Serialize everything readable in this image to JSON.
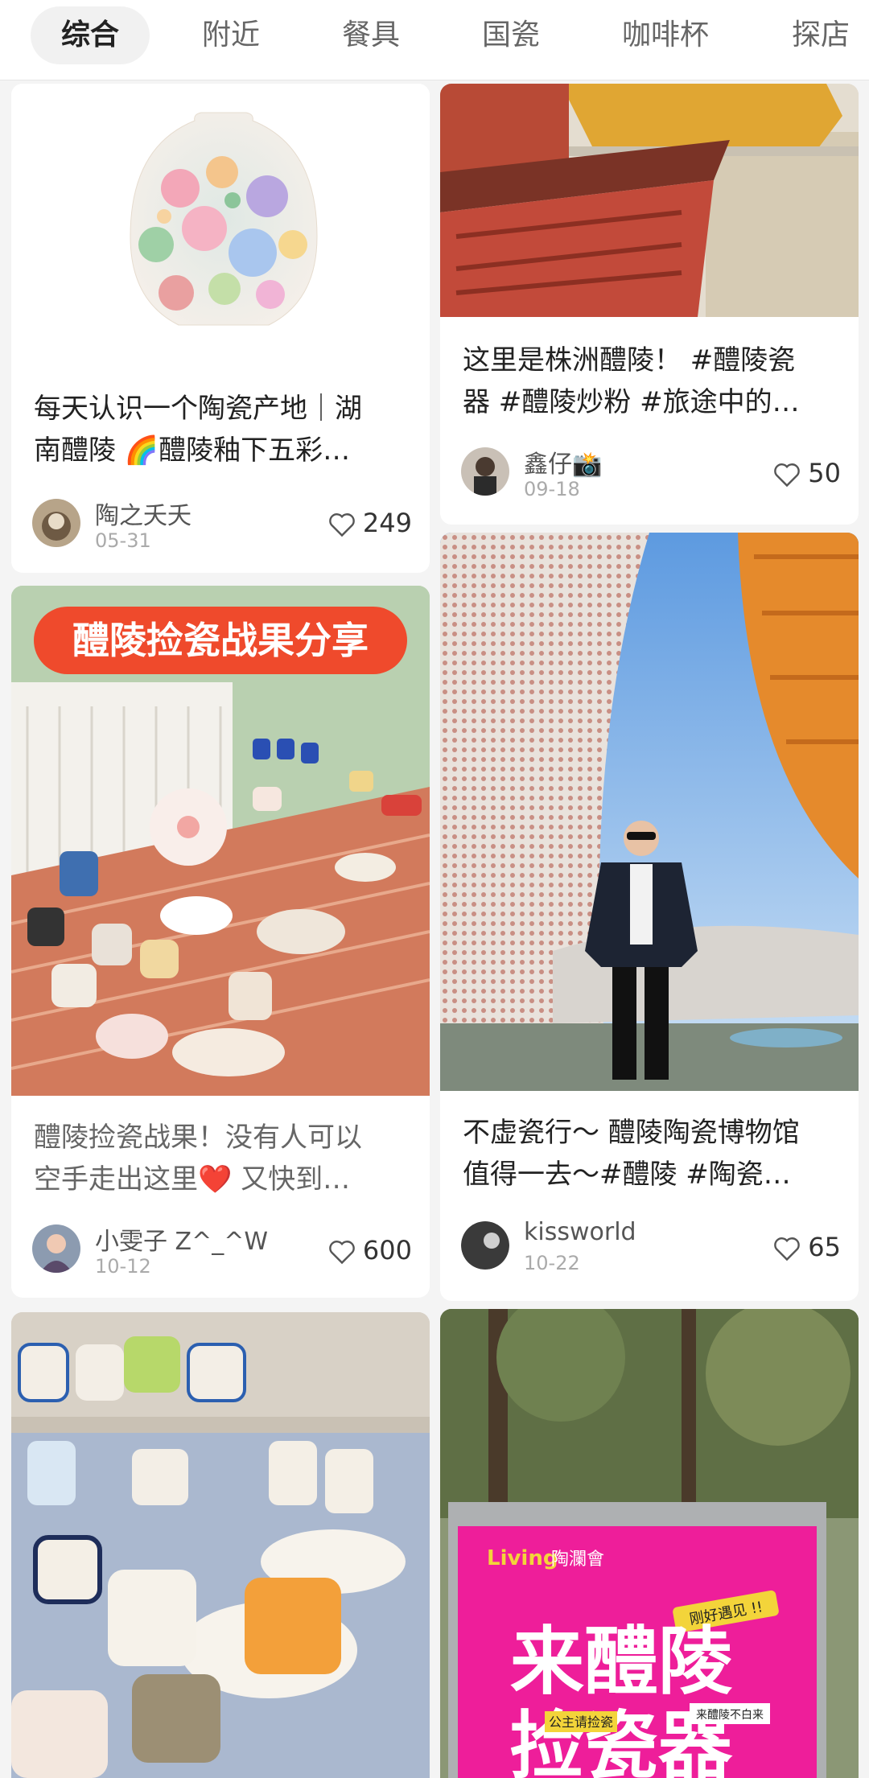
{
  "tabs": [
    {
      "label": "综合",
      "active": true
    },
    {
      "label": "附近"
    },
    {
      "label": "餐具"
    },
    {
      "label": "国瓷"
    },
    {
      "label": "咖啡杯"
    },
    {
      "label": "探店"
    }
  ],
  "posts": [
    {
      "caption_line1": "每天认识一个陶瓷产地｜湖",
      "caption_line2": "南醴陵 🌈醴陵釉下五彩…",
      "user": "陶之夭夭",
      "date": "05-31",
      "likes": "249"
    },
    {
      "caption_line1": "这里是株洲醴陵！ #醴陵瓷",
      "caption_line2": "器 #醴陵炒粉 #旅途中的…",
      "user": "鑫仔📸",
      "date": "09-18",
      "likes": "50"
    },
    {
      "banner": "醴陵捡瓷战果分享",
      "caption_line1": "醴陵捡瓷战果！没有人可以",
      "caption_line2": "空手走出这里❤️ 又快到…",
      "user": "小雯子 Z^_^W",
      "date": "10-12",
      "likes": "600"
    },
    {
      "caption_line1": "不虚瓷行～ 醴陵陶瓷博物馆",
      "caption_line2": "值得一去～#醴陵 #陶瓷…",
      "user": "kissworld",
      "date": "10-22",
      "likes": "65"
    },
    {},
    {
      "sign_brand": "陶瀾會",
      "sign_tag": "刚好遇见 !!",
      "sign_title1": "来醴陵",
      "sign_title2": "捡瓷器",
      "sign_small1": "公主请捡瓷",
      "sign_small2": "来醴陵不白来"
    }
  ]
}
